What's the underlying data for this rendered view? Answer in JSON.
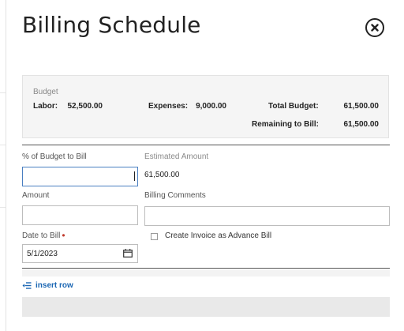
{
  "dialog": {
    "title": "Billing Schedule",
    "close_icon": "close-circle-icon"
  },
  "budget": {
    "heading": "Budget",
    "labor_label": "Labor:",
    "labor_value": "52,500.00",
    "expenses_label": "Expenses:",
    "expenses_value": "9,000.00",
    "total_label": "Total Budget:",
    "total_value": "61,500.00",
    "remaining_label": "Remaining to Bill:",
    "remaining_value": "61,500.00"
  },
  "form": {
    "percent_label": "% of Budget to Bill",
    "percent_value": "",
    "estimated_label": "Estimated Amount",
    "estimated_value": "61,500.00",
    "amount_label": "Amount",
    "amount_value": "",
    "comments_label": "Billing Comments",
    "comments_value": "",
    "date_label": "Date to Bill",
    "date_value": "5/1/2023",
    "advance_bill_label": "Create Invoice as Advance Bill",
    "advance_bill_checked": false
  },
  "actions": {
    "insert_row_label": "insert row"
  },
  "colors": {
    "link": "#1a66b3",
    "required": "#c0392b",
    "focus": "#4a7fc1"
  }
}
